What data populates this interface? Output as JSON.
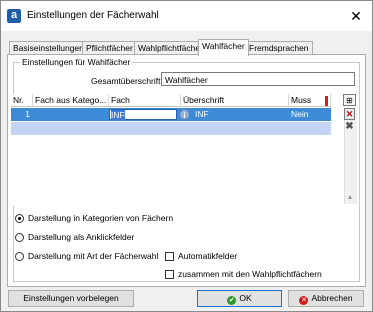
{
  "window": {
    "title": "Einstellungen der Fächerwahl",
    "close_glyph": "✕",
    "app_icon_letter": "a"
  },
  "tabs": [
    {
      "label": "Basiseinstellungen",
      "active": false
    },
    {
      "label": "Pflichtfächer",
      "active": false
    },
    {
      "label": "Wahlpflichtfächer",
      "active": false
    },
    {
      "label": "Wahlfächer",
      "active": true
    },
    {
      "label": "Fremdsprachen",
      "active": false
    }
  ],
  "group": {
    "legend": "Einstellungen für Wahlfächer",
    "gesamt_label": "Gesamtüberschrift",
    "gesamt_value": "Wahlfächer"
  },
  "grid": {
    "headers": [
      "Nr.",
      "Fach aus Katego...",
      "Fach",
      "Überschrift",
      "Muss"
    ],
    "rows": [
      {
        "nr": "1",
        "kategorie": "",
        "fach": "INF",
        "ueberschrift": "INF",
        "muss": "Nein"
      }
    ],
    "column_button_glyph": "⊞",
    "delete_glyph": "✕"
  },
  "options": {
    "radio1": "Darstellung in Kategorien von Fächern",
    "radio2": "Darstellung als Anklickfelder",
    "radio3": "Darstellung mit Art der Fächerwahl",
    "check1": "Automatikfelder",
    "check2": "zusammen mit den Wahlpflichtfächern",
    "selected_radio": 1
  },
  "buttons": {
    "defaults": "Einstellungen vorbelegen",
    "ok": "OK",
    "cancel": "Abbrechen"
  },
  "colors": {
    "selection_row": "#3d8ad6",
    "second_row": "#c5d3f5",
    "ok_icon": "#2c9a2c",
    "cancel_icon": "#d01c1c"
  }
}
